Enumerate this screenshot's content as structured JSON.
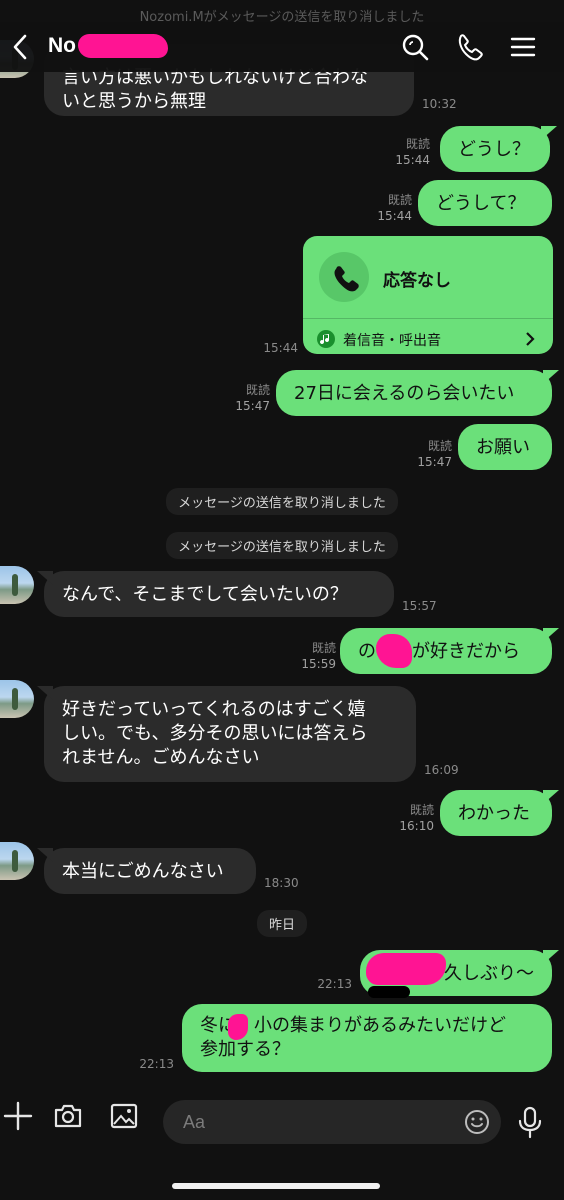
{
  "top_notice": "Nozomi.Mがメッセージの送信を取り消しました",
  "header": {
    "title": "No",
    "icons": [
      "back-icon",
      "search-icon",
      "phone-icon",
      "menu-icon"
    ]
  },
  "messages": [
    {
      "text": "言い方は悪いかもしれないけど合わな\nいと思うから無理",
      "time": "10:32"
    },
    {
      "text": "どうし？",
      "read": "既読",
      "time": "15:44"
    },
    {
      "text": "どうして？",
      "read": "既読",
      "time": "15:44"
    },
    {
      "title": "応答なし",
      "subtitle": "着信音・呼出音",
      "time": "15:44"
    },
    {
      "text": "27日に会えるのら会いたい",
      "read": "既読",
      "time": "15:47"
    },
    {
      "text": "お願い",
      "read": "既読",
      "time": "15:47"
    },
    {
      "text": "メッセージの送信を取り消しました"
    },
    {
      "text": "メッセージの送信を取り消しました"
    },
    {
      "text": "なんで、そこまでして会いたいの？",
      "time": "15:57"
    },
    {
      "text": "の　　が好きだから",
      "read": "既読",
      "time": "15:59"
    },
    {
      "text": "好きだっていってくれるのはすごく嬉\nしい。でも、多分その思いには答えら\nれません。ごめんなさい",
      "time": "16:09"
    },
    {
      "text": "わかった",
      "read": "既読",
      "time": "16:10"
    },
    {
      "text": "本当にごめんなさい",
      "time": "18:30"
    },
    {
      "text": "昨日"
    },
    {
      "text": "久しぶり〜",
      "time": "22:13"
    },
    {
      "text": "冬に　小の集まりがあるみたいだけど\n参加する？",
      "time": "22:13"
    }
  ],
  "composer": {
    "placeholder": "Aa",
    "icons": [
      "plus-icon",
      "camera-icon",
      "image-icon",
      "emoji-icon",
      "mic-icon"
    ]
  },
  "colors": {
    "background": "#111111",
    "outgoing": "#6be07a",
    "incoming": "#2b2b2b",
    "redaction": "#ff1493"
  }
}
